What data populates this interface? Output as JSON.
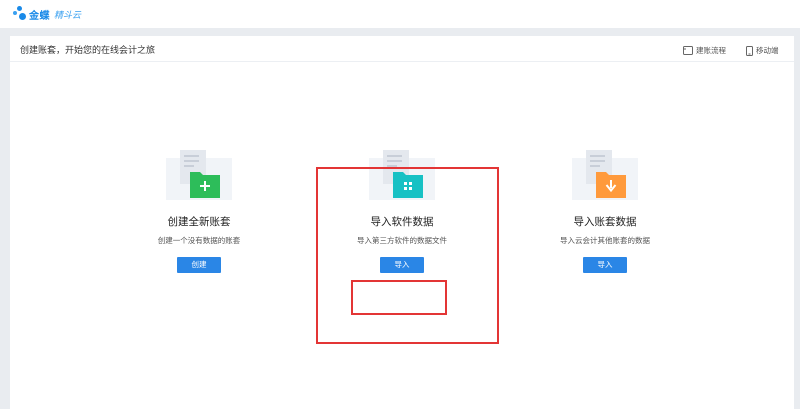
{
  "app": {
    "brand": "金蝶",
    "product": "精斗云"
  },
  "header": {
    "title": "创建账套，开始您的在线会计之旅",
    "links": [
      {
        "label": "建账流程",
        "icon": "flowchart-icon"
      },
      {
        "label": "移动端",
        "icon": "mobile-phone-icon"
      }
    ]
  },
  "cards": [
    {
      "title": "创建全新账套",
      "desc": "创建一个没有数据的账套",
      "button": "创建",
      "folder_color": "#2dbd5a",
      "icon": "plus-icon"
    },
    {
      "title": "导入软件数据",
      "desc": "导入第三方软件的数据文件",
      "button": "导入",
      "folder_color": "#17c1c4",
      "icon": "grid-icon"
    },
    {
      "title": "导入账套数据",
      "desc": "导入云会计其他账套的数据",
      "button": "导入",
      "folder_color": "#ff9a3c",
      "icon": "arrow-down-icon"
    }
  ],
  "colors": {
    "accent": "#2a86e6",
    "highlight": "#e33535"
  }
}
